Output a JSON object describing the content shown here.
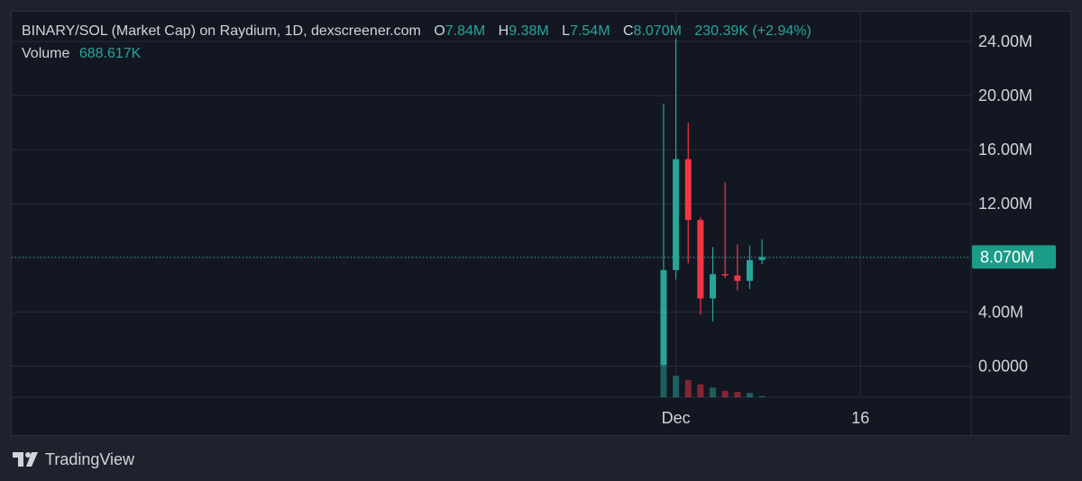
{
  "legend": {
    "title": "BINARY/SOL (Market Cap) on Raydium, 1D, dexscreener.com",
    "o_label": "O",
    "o_value": "7.84M",
    "h_label": "H",
    "h_value": "9.38M",
    "l_label": "L",
    "l_value": "7.54M",
    "c_label": "C",
    "c_value": "8.070M",
    "change": "230.39K (+2.94%)",
    "volume_label": "Volume",
    "volume_value": "688.617K"
  },
  "branding": {
    "name": "TradingView"
  },
  "colors": {
    "up": "#26a69a",
    "down": "#f23645",
    "background": "#131722",
    "grid": "#2a2e39",
    "text": "#d1d4dc",
    "price_label_bg": "#1a9c86"
  },
  "chart_data": {
    "type": "candlestick",
    "title": "BINARY/SOL (Market Cap) on Raydium, 1D, dexscreener.com",
    "y_ticks": [
      "24.00M",
      "20.00M",
      "16.00M",
      "12.00M",
      "8.000M",
      "4.00M",
      "0.0000"
    ],
    "y_tick_values": [
      24,
      20,
      16,
      12,
      8,
      4,
      0
    ],
    "y_unit": "M",
    "ylim": [
      -2.3,
      26.2
    ],
    "x_ticks": [
      {
        "label": "Dec",
        "day": 0
      },
      {
        "label": "16",
        "day": 15
      }
    ],
    "x_range_days": [
      -54,
      24
    ],
    "last_price": 8.07,
    "last_price_label": "8.070M",
    "candles": [
      {
        "day": -1,
        "open": 0.1,
        "high": 19.4,
        "low": 0.0,
        "close": 7.1,
        "volume": 1.6
      },
      {
        "day": 0,
        "open": 7.1,
        "high": 24.2,
        "low": 6.4,
        "close": 15.3,
        "volume": 1.0
      },
      {
        "day": 1,
        "open": 15.3,
        "high": 18.0,
        "low": 7.6,
        "close": 10.8,
        "volume": 0.8
      },
      {
        "day": 2,
        "open": 10.8,
        "high": 11.0,
        "low": 3.8,
        "close": 5.0,
        "volume": 0.6
      },
      {
        "day": 3,
        "open": 5.0,
        "high": 8.8,
        "low": 3.3,
        "close": 6.8,
        "volume": 0.45
      },
      {
        "day": 4,
        "open": 6.8,
        "high": 13.6,
        "low": 6.5,
        "close": 6.7,
        "volume": 0.3
      },
      {
        "day": 5,
        "open": 6.7,
        "high": 9.0,
        "low": 5.6,
        "close": 6.3,
        "volume": 0.25
      },
      {
        "day": 6,
        "open": 6.3,
        "high": 8.9,
        "low": 5.7,
        "close": 7.84,
        "volume": 0.2
      },
      {
        "day": 7,
        "open": 7.84,
        "high": 9.38,
        "low": 7.54,
        "close": 8.07,
        "volume": 0.05
      }
    ]
  }
}
